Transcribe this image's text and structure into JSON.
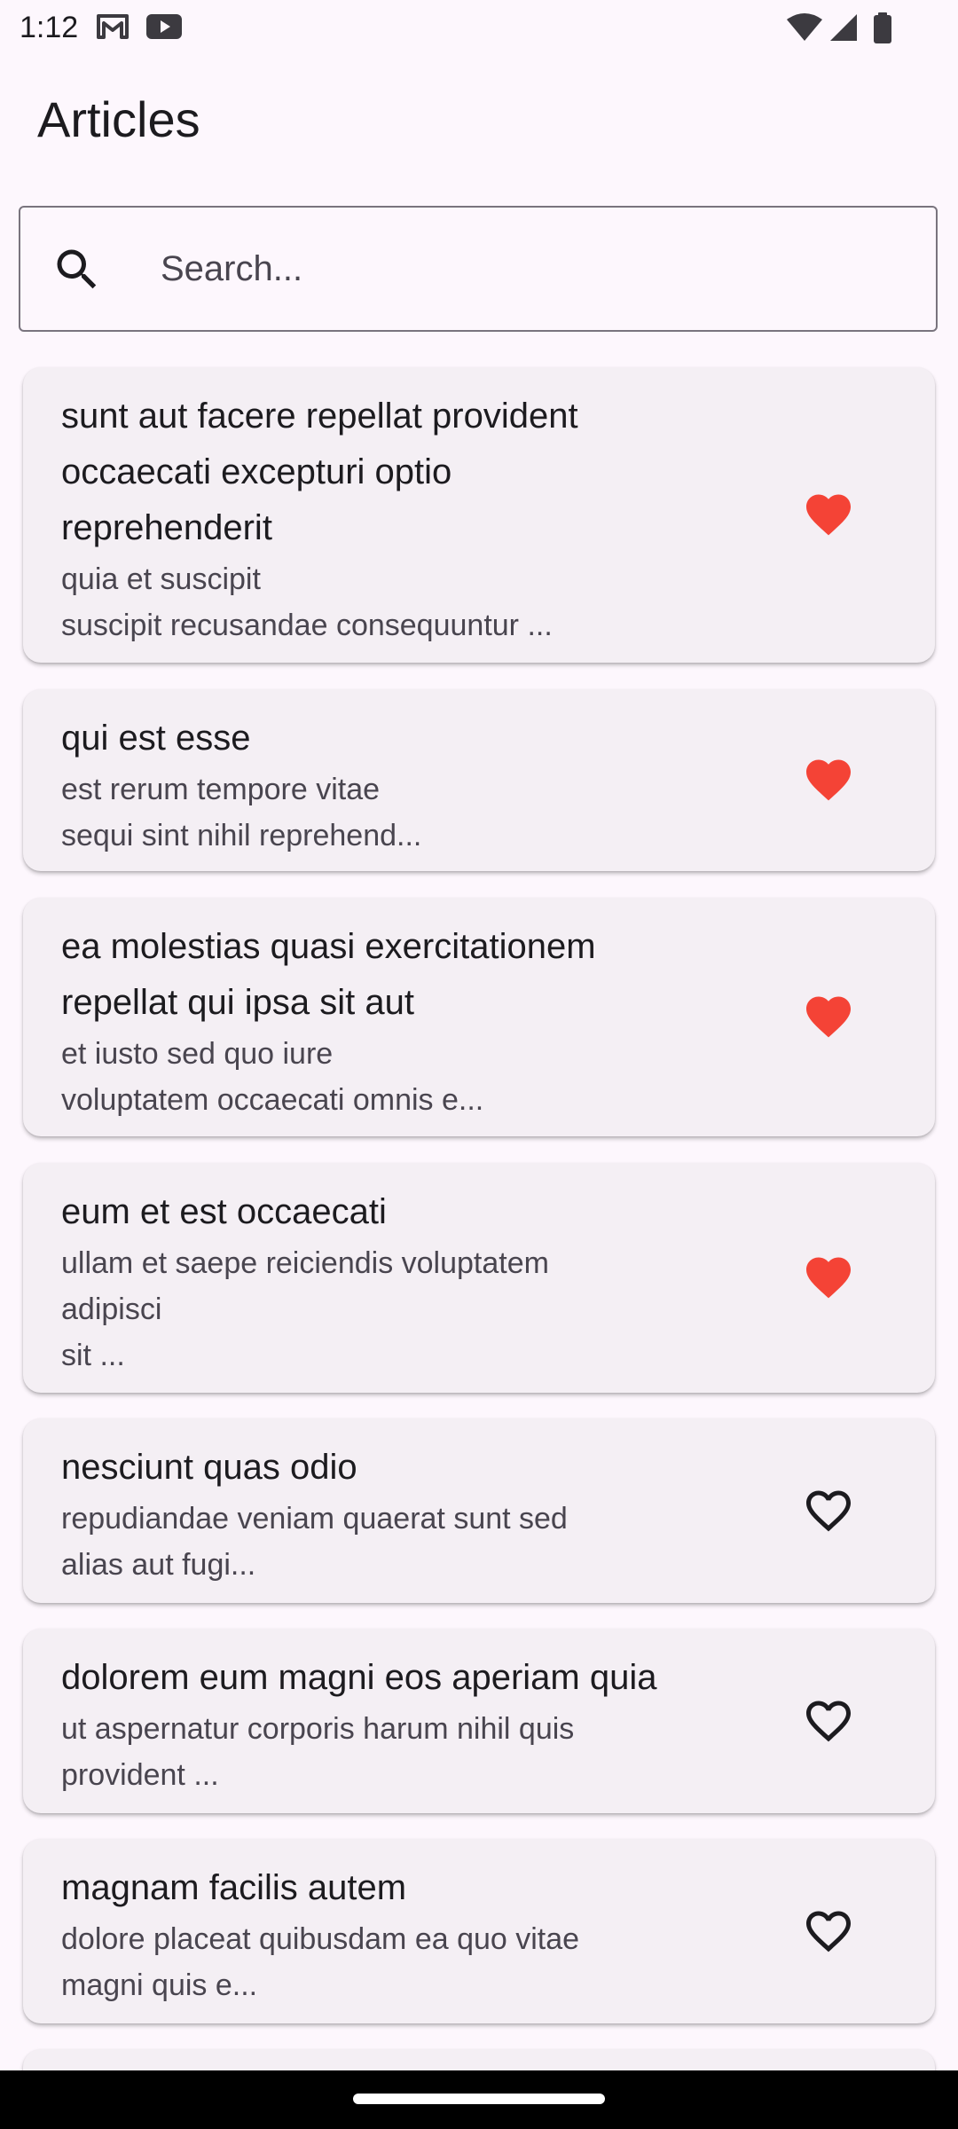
{
  "status_bar": {
    "time": "1:12",
    "left_icons": [
      "gmail-icon",
      "youtube-icon"
    ],
    "right_icons": [
      "wifi-icon",
      "cellular-signal-icon",
      "battery-icon"
    ]
  },
  "app_bar": {
    "title": "Articles"
  },
  "search": {
    "placeholder": "Search...",
    "value": "",
    "icon": "search-icon"
  },
  "colors": {
    "background": "#fdf7fd",
    "card": "#f4eff4",
    "favorite_active": "#f44336",
    "favorite_inactive": "#1c1b1f",
    "title_text": "#1c1b1f",
    "body_text": "#49454f"
  },
  "articles": [
    {
      "title": "sunt aut facere repellat provident\noccaecati excepturi optio\nreprehenderit",
      "body": "quia et suscipit\nsuscipit recusandae consequuntur ...",
      "favorite": true
    },
    {
      "title": "qui est esse",
      "body": "est rerum tempore vitae\nsequi sint nihil reprehend...",
      "favorite": true
    },
    {
      "title": "ea molestias quasi exercitationem\nrepellat qui ipsa sit aut",
      "body": "et iusto sed quo iure\nvoluptatem occaecati omnis e...",
      "favorite": true
    },
    {
      "title": "eum et est occaecati",
      "body": "ullam et saepe reiciendis voluptatem\nadipisci\nsit ...",
      "favorite": true
    },
    {
      "title": "nesciunt quas odio",
      "body": "repudiandae veniam quaerat sunt sed\nalias aut fugi...",
      "favorite": false
    },
    {
      "title": "dolorem eum magni eos aperiam quia",
      "body": "ut aspernatur corporis harum nihil quis\nprovident ...",
      "favorite": false
    },
    {
      "title": "magnam facilis autem",
      "body": "dolore placeat quibusdam ea quo vitae\nmagni quis e...",
      "favorite": false
    }
  ]
}
